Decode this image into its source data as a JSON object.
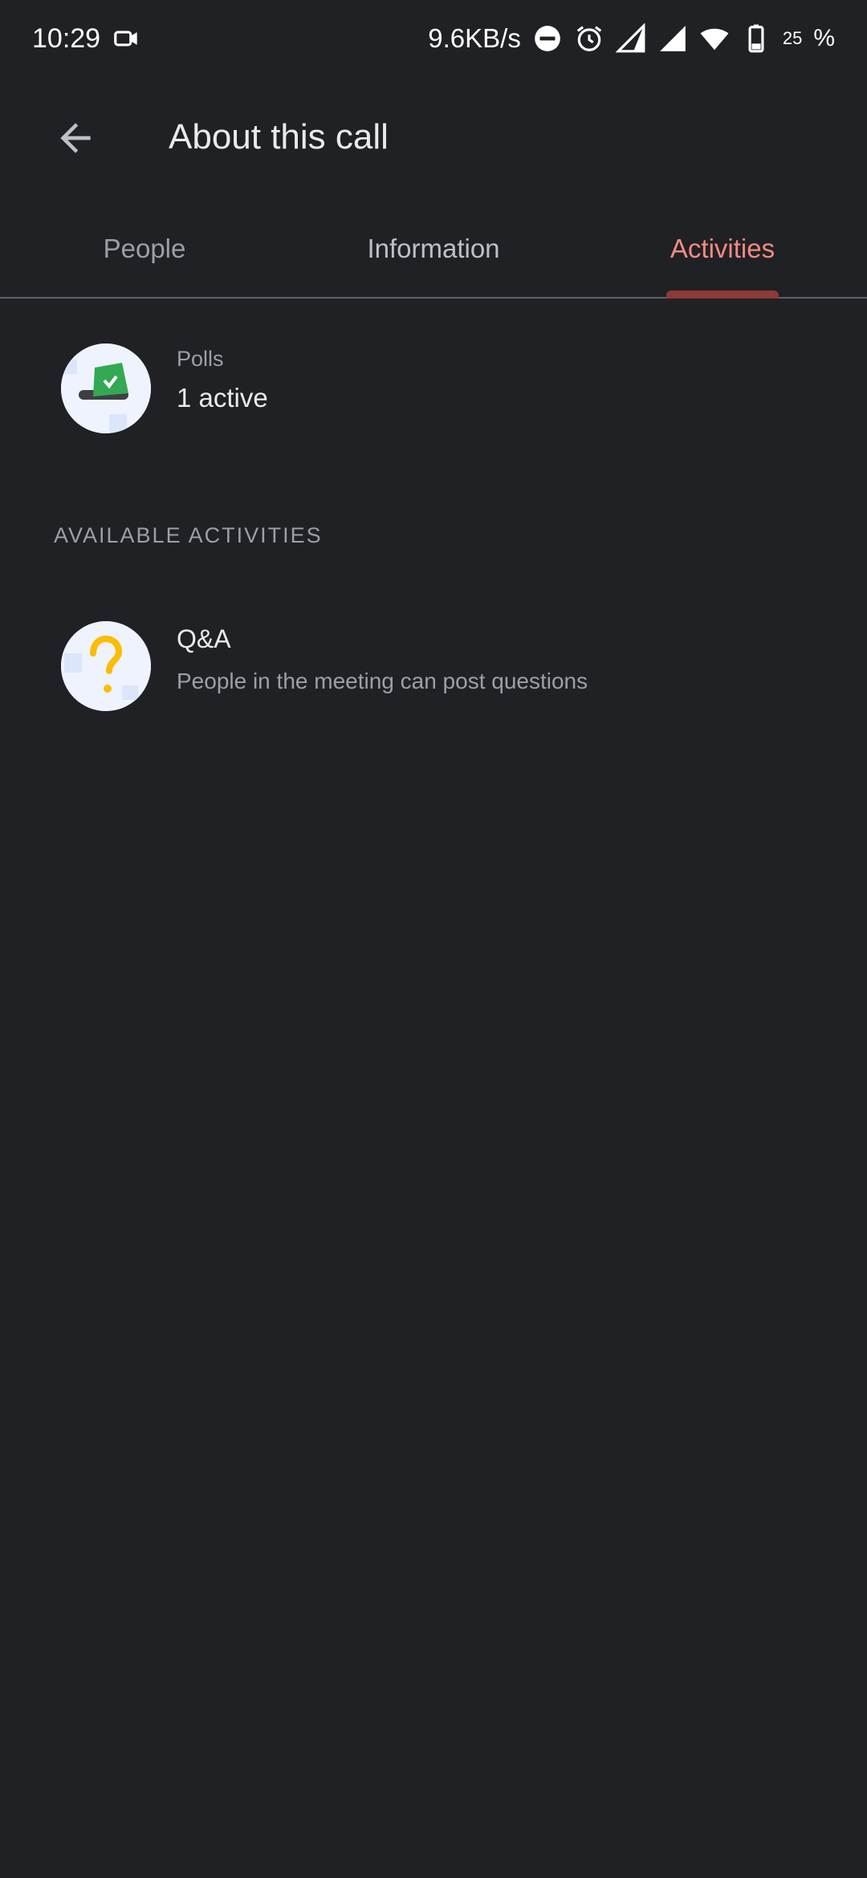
{
  "status_bar": {
    "time": "10:29",
    "net_speed": "9.6KB/s",
    "battery_level": "25",
    "battery_percent_sign": "%",
    "icons": [
      "video-camera-icon",
      "do-not-disturb-icon",
      "alarm-icon",
      "signal-icon",
      "signal-icon",
      "wifi-icon",
      "battery-icon"
    ]
  },
  "app_bar": {
    "back_icon": "arrow-back-icon",
    "title": "About this call"
  },
  "tabs": [
    {
      "label": "People",
      "active": false
    },
    {
      "label": "Information",
      "active": false
    },
    {
      "label": "Activities",
      "active": true
    }
  ],
  "polls": {
    "icon": "poll-ballot-icon",
    "overline": "Polls",
    "value": "1 active"
  },
  "section_header": "AVAILABLE ACTIVITIES",
  "qa": {
    "icon": "question-mark-icon",
    "title": "Q&A",
    "subtitle": "People in the meeting can post questions"
  },
  "colors": {
    "background": "#202124",
    "active_tab": "#f28b82",
    "tab_indicator": "#8c3b36",
    "poll_green": "#34a853",
    "qa_yellow": "#fbbc04"
  }
}
